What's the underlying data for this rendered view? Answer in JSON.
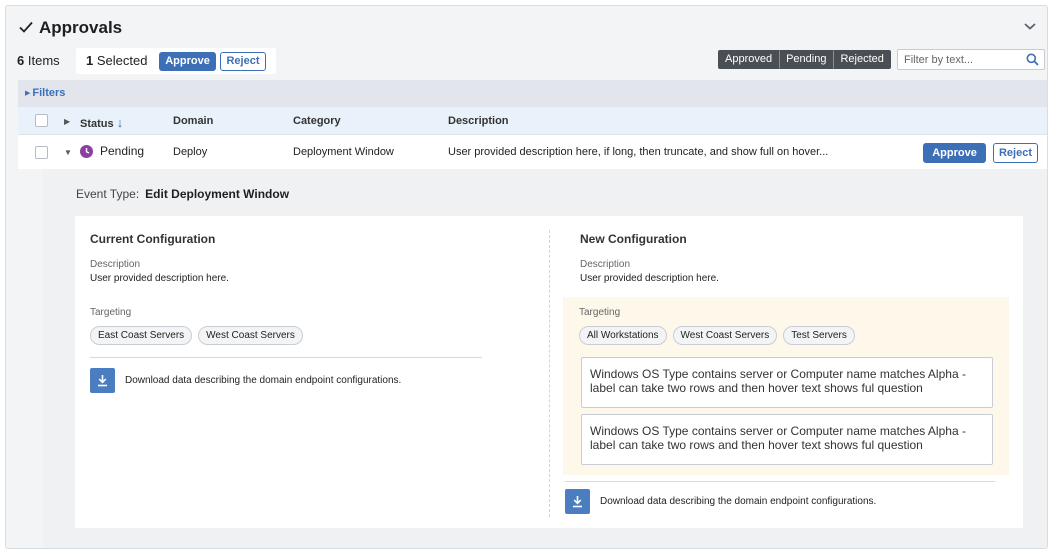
{
  "header": {
    "title": "Approvals"
  },
  "toolbar": {
    "items_count": "6",
    "items_label": "Items",
    "selected_count": "1",
    "selected_label": "Selected",
    "approve_label": "Approve",
    "reject_label": "Reject",
    "segments": [
      "Approved",
      "Pending",
      "Rejected"
    ],
    "search_placeholder": "Filter by text..."
  },
  "filters": {
    "label": "Filters"
  },
  "table": {
    "columns": {
      "status": "Status",
      "domain": "Domain",
      "category": "Category",
      "description": "Description"
    },
    "sort_arrow": "↓",
    "rows": [
      {
        "status": "Pending",
        "domain": "Deploy",
        "category": "Deployment Window",
        "description": "User provided description here, if long, then truncate, and show full on hover...",
        "approve_label": "Approve",
        "reject_label": "Reject"
      }
    ]
  },
  "detail": {
    "event_type_label": "Event Type:",
    "event_type_value": "Edit Deployment Window",
    "current": {
      "title": "Current Configuration",
      "description_label": "Description",
      "description_value": "User provided description here.",
      "targeting_label": "Targeting",
      "chips": [
        "East Coast Servers",
        "West Coast Servers"
      ],
      "download_text": "Download data describing the domain endpoint configurations."
    },
    "new": {
      "title": "New Configuration",
      "description_label": "Description",
      "description_value": "User provided description here.",
      "targeting_label": "Targeting",
      "chips": [
        "All Workstations",
        "West Coast Servers",
        "Test Servers"
      ],
      "queries": [
        "Windows OS Type contains server or Computer name matches Alpha - label can take two rows and then hover text shows ful question",
        "Windows OS Type contains server or Computer name matches Alpha - label can take two rows and then hover text shows ful question"
      ],
      "download_text": "Download data describing the domain endpoint configurations."
    }
  },
  "colors": {
    "primary": "#3d6fb6",
    "pending": "#8b3fa0",
    "segment_bg": "#4a4f56",
    "highlight_bg": "#fdf8e9",
    "header_row_bg": "#e9f1fb"
  },
  "icons": {
    "title": "checkmark-icon",
    "collapse": "chevron-down-icon",
    "search": "search-icon",
    "sort": "arrow-down-icon",
    "pending": "clock-icon",
    "download": "download-icon",
    "expand": "caret-right-icon",
    "collapse_row": "caret-down-icon"
  }
}
